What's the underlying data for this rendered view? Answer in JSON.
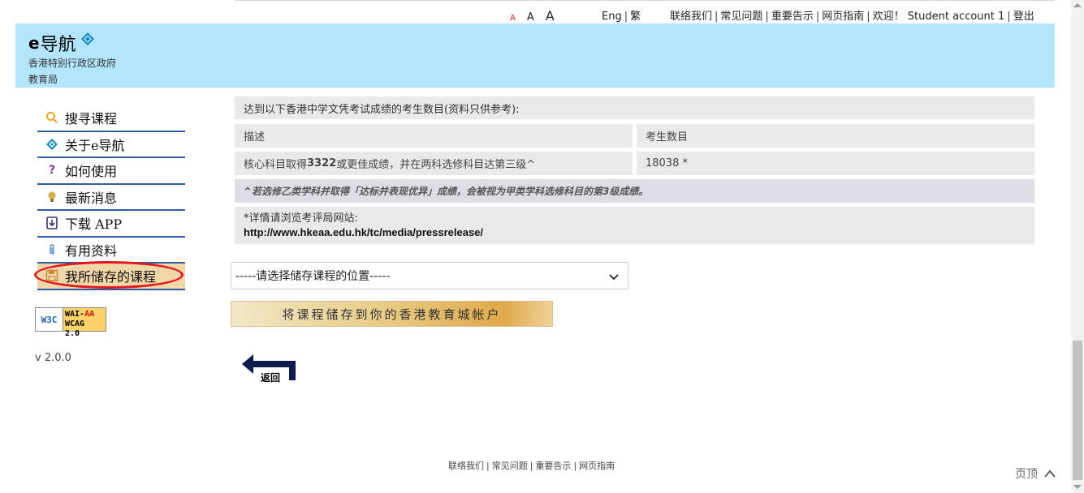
{
  "top": {
    "font_sizes": [
      "A",
      "A",
      "A"
    ],
    "lang": {
      "eng": "Eng",
      "trad": "繁"
    },
    "links": [
      "联络我们",
      "常见问题",
      "重要告示",
      "网页指南"
    ],
    "welcome": "欢迎！",
    "user": "Student account 1",
    "logout": "登出"
  },
  "header": {
    "title_e": "e",
    "title_rest": "导航",
    "line1": "香港特别行政区政府",
    "line2": "教育局"
  },
  "sidebar": {
    "items": [
      {
        "label": "搜寻课程",
        "icon": "search-icon"
      },
      {
        "label": "关于e导航",
        "icon": "diamond-logo-icon"
      },
      {
        "label": "如何使用",
        "icon": "question-icon"
      },
      {
        "label": "最新消息",
        "icon": "lightbulb-icon"
      },
      {
        "label": "下载 APP",
        "icon": "download-icon"
      },
      {
        "label": "有用资料",
        "icon": "paperclip-icon"
      },
      {
        "label": "我所储存的课程",
        "icon": "save-icon"
      }
    ],
    "badge": {
      "left": "W3C",
      "line1a": "WAI-",
      "line1b": "AA",
      "line2": "WCAG 2.0"
    },
    "version": "v 2.0.0"
  },
  "main": {
    "intro": "达到以下香港中学文凭考试成绩的考生数目(资料只供参考):",
    "col_desc": "描述",
    "col_count": "考生数目",
    "row_desc_pre": "核心科目取得",
    "row_desc_bold": "3322",
    "row_desc_post": "或更佳成绩，并在两科选修科目达第三级^",
    "row_count": "18038 *",
    "note": "^若选修乙类学科并取得「达标并表现优异」成绩，会被视为甲类学科选修科目的第3级成绩。",
    "detail_line1": "*详情请浏览考评局网站:",
    "detail_url": "http://www.hkeaa.edu.hk/tc/media/pressrelease/",
    "select_value": "-----请选择储存课程的位置-----",
    "save_button": "将课程储存到你的香港教育城帐户",
    "back_label": "返回"
  },
  "footer": {
    "links": [
      "联络我们",
      "常见问题",
      "重要告示",
      "网页指南"
    ],
    "to_top": "页顶"
  },
  "colors": {
    "header_bg": "#b3e5fc",
    "nav_border": "#2d5ba8",
    "highlight": "#e0191f"
  }
}
